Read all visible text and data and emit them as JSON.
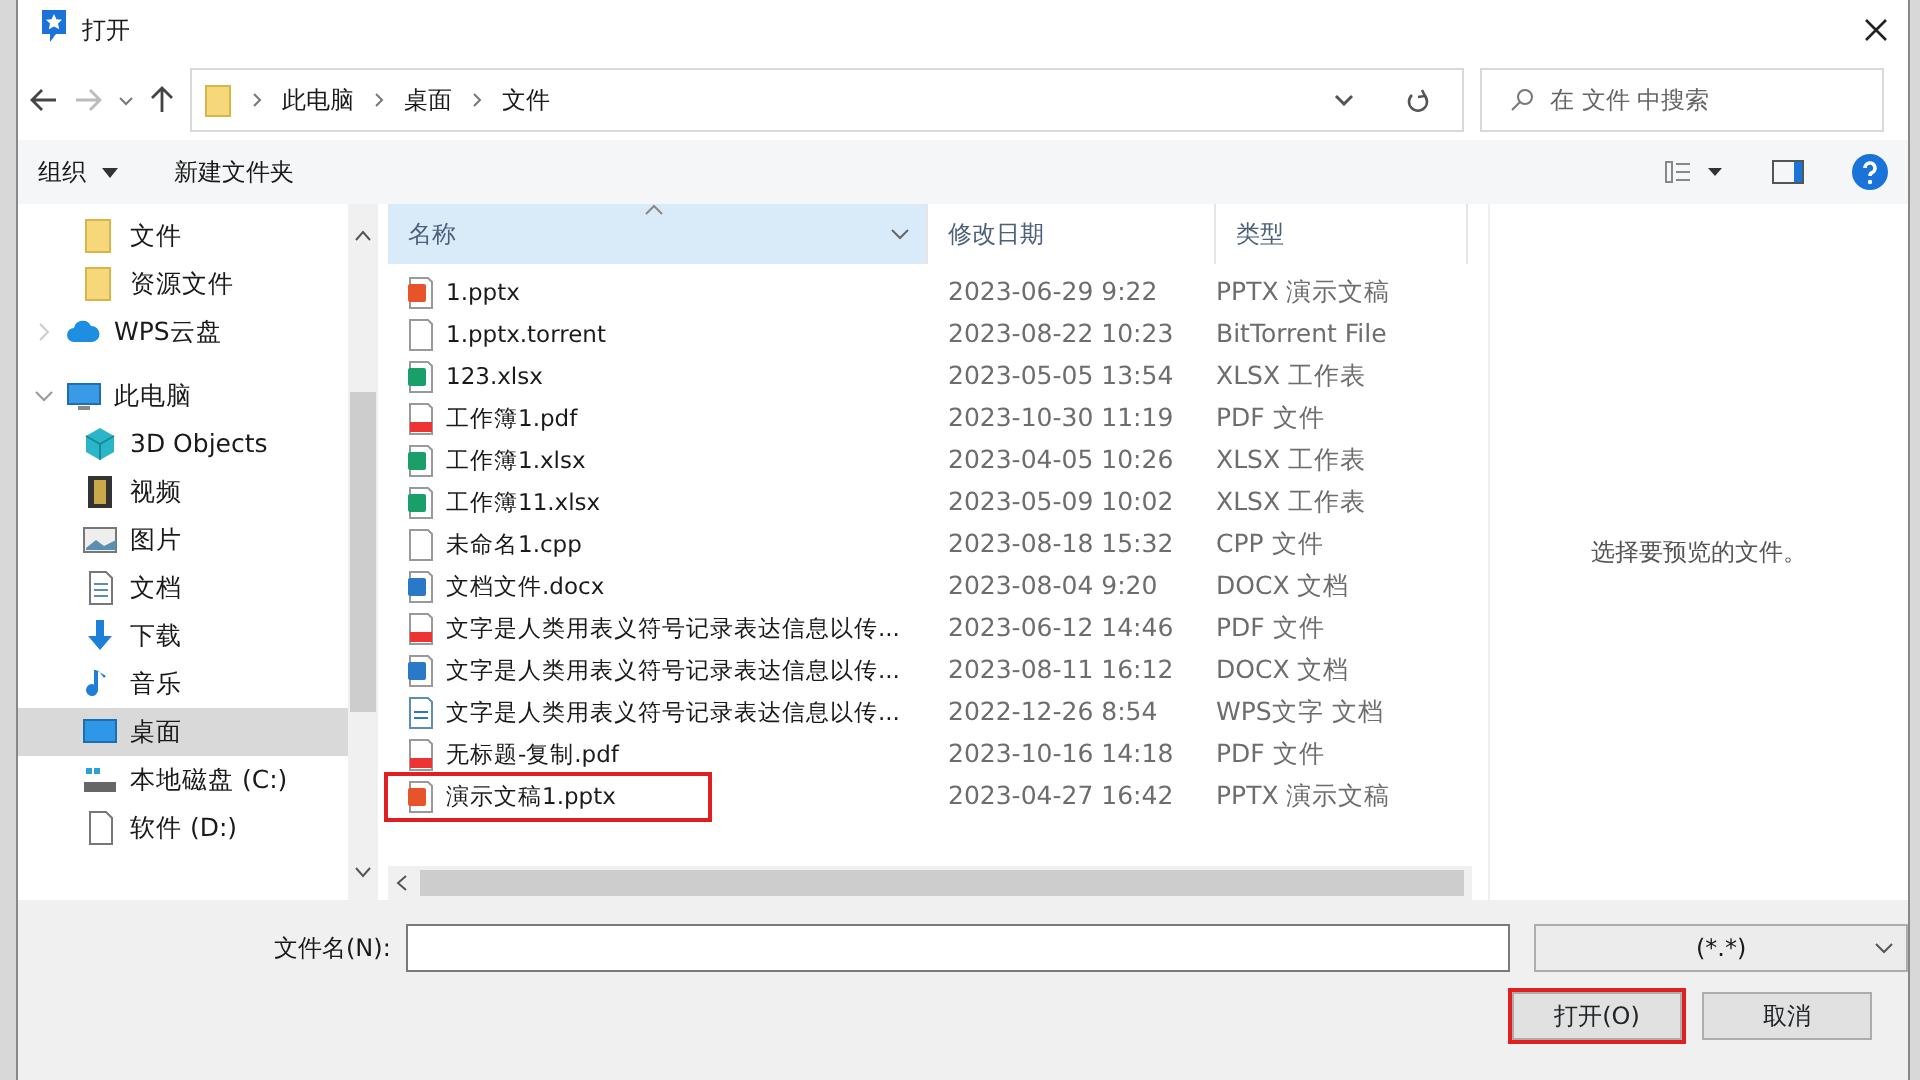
{
  "window": {
    "title": "打开"
  },
  "address": {
    "crumbs": [
      "此电脑",
      "桌面",
      "文件"
    ],
    "search_placeholder": "在 文件 中搜索"
  },
  "toolbar": {
    "organize": "组织",
    "new_folder": "新建文件夹"
  },
  "sidebar": {
    "items": [
      {
        "label": "文件",
        "kind": "folder",
        "indent": true,
        "selected": false
      },
      {
        "label": "资源文件",
        "kind": "folder",
        "indent": true,
        "selected": false
      },
      {
        "label": "WPS云盘",
        "kind": "cloud",
        "selected": false
      },
      {
        "label": "此电脑",
        "kind": "pc",
        "expanded": true,
        "selected": false,
        "children": [
          {
            "label": "3D Objects",
            "kind": "cube",
            "selected": false
          },
          {
            "label": "视频",
            "kind": "film",
            "selected": false
          },
          {
            "label": "图片",
            "kind": "image",
            "selected": false
          },
          {
            "label": "文档",
            "kind": "doc",
            "selected": false
          },
          {
            "label": "下载",
            "kind": "download",
            "selected": false
          },
          {
            "label": "音乐",
            "kind": "music",
            "selected": false
          },
          {
            "label": "桌面",
            "kind": "desktop",
            "selected": true
          },
          {
            "label": "本地磁盘 (C:)",
            "kind": "drive",
            "selected": false
          },
          {
            "label": "软件 (D:)",
            "kind": "blank",
            "selected": false
          }
        ]
      }
    ]
  },
  "table": {
    "columns": [
      "名称",
      "修改日期",
      "类型"
    ],
    "rows": [
      {
        "name": "1.pptx",
        "date": "2023-06-29 9:22",
        "type": "PPTX 演示文稿",
        "kind": "ppt",
        "highlighted": false
      },
      {
        "name": "1.pptx.torrent",
        "date": "2023-08-22 10:23",
        "type": "BitTorrent File",
        "kind": "blank",
        "highlighted": false
      },
      {
        "name": "123.xlsx",
        "date": "2023-05-05 13:54",
        "type": "XLSX 工作表",
        "kind": "sheet",
        "highlighted": false
      },
      {
        "name": "工作簿1.pdf",
        "date": "2023-10-30 11:19",
        "type": "PDF 文件",
        "kind": "pdf",
        "highlighted": false
      },
      {
        "name": "工作簿1.xlsx",
        "date": "2023-04-05 10:26",
        "type": "XLSX 工作表",
        "kind": "sheet",
        "highlighted": false
      },
      {
        "name": "工作簿11.xlsx",
        "date": "2023-05-09 10:02",
        "type": "XLSX 工作表",
        "kind": "sheet",
        "highlighted": false
      },
      {
        "name": "未命名1.cpp",
        "date": "2023-08-18 15:32",
        "type": "CPP 文件",
        "kind": "blank",
        "highlighted": false
      },
      {
        "name": "文档文件.docx",
        "date": "2023-08-04 9:20",
        "type": "DOCX 文档",
        "kind": "word",
        "highlighted": false
      },
      {
        "name": "文字是人类用表义符号记录表达信息以传...",
        "date": "2023-06-12 14:46",
        "type": "PDF 文件",
        "kind": "pdf",
        "highlighted": false
      },
      {
        "name": "文字是人类用表义符号记录表达信息以传...",
        "date": "2023-08-11 16:12",
        "type": "DOCX 文档",
        "kind": "word",
        "highlighted": false
      },
      {
        "name": "文字是人类用表义符号记录表达信息以传...",
        "date": "2022-12-26 8:54",
        "type": "WPS文字 文档",
        "kind": "text",
        "highlighted": false
      },
      {
        "name": "无标题-复制.pdf",
        "date": "2023-10-16 14:18",
        "type": "PDF 文件",
        "kind": "pdf",
        "highlighted": false
      },
      {
        "name": "演示文稿1.pptx",
        "date": "2023-04-27 16:42",
        "type": "PPTX 演示文稿",
        "kind": "ppt",
        "highlighted": true
      }
    ]
  },
  "preview": {
    "message": "选择要预览的文件。"
  },
  "footer": {
    "filename_label": "文件名(N):",
    "filter": "(*.*)",
    "buttons": [
      {
        "label": "打开(O)",
        "highlighted": true
      },
      {
        "label": "取消",
        "highlighted": false
      }
    ]
  }
}
